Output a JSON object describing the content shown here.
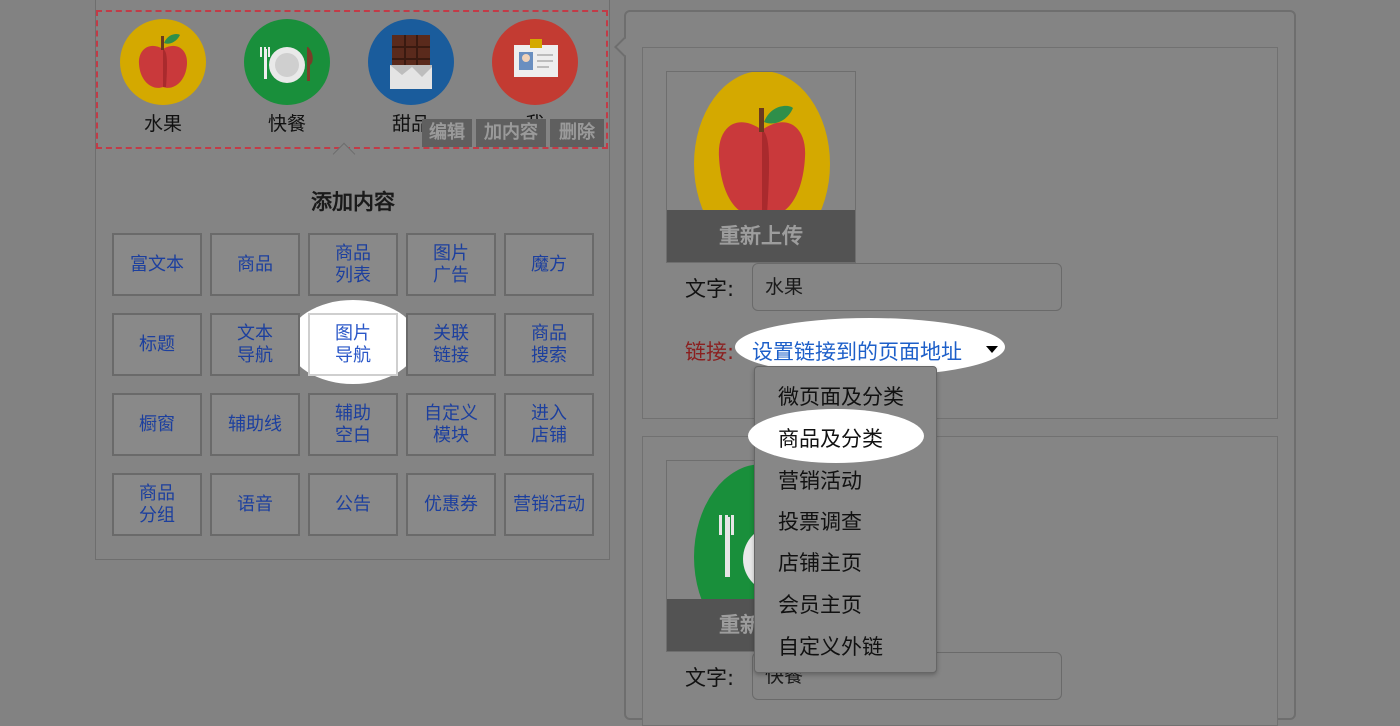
{
  "nav_preview": {
    "items": [
      {
        "label": "水果",
        "icon": "apple-icon",
        "color": "#d4a900"
      },
      {
        "label": "快餐",
        "icon": "plate-cutlery-icon",
        "color": "#198f3b"
      },
      {
        "label": "甜品",
        "icon": "chocolate-icon",
        "color": "#1a5c9c"
      },
      {
        "label": "我",
        "icon": "id-badge-icon",
        "color": "#c33b32"
      }
    ],
    "tools": {
      "edit": "编辑",
      "add": "加内容",
      "delete": "删除"
    }
  },
  "add_content": {
    "title": "添加内容",
    "buttons": [
      "富文本",
      "商品",
      "商品\n列表",
      "图片\n广告",
      "魔方",
      "标题",
      "文本\n导航",
      "图片\n导航",
      "关联\n链接",
      "商品\n搜索",
      "橱窗",
      "辅助线",
      "辅助\n空白",
      "自定义\n模块",
      "进入\n店铺",
      "商品\n分组",
      "语音",
      "公告",
      "优惠券",
      "营销活动"
    ]
  },
  "editor": {
    "card1": {
      "reupload": "重新上传",
      "text_label": "文字:",
      "text_value": "水果",
      "link_label": "链接:",
      "link_select": "设置链接到的页面地址"
    },
    "card2": {
      "reupload": "重新上传",
      "text_label": "文字:",
      "text_value": "快餐"
    },
    "link_dropdown": [
      "微页面及分类",
      "商品及分类",
      "营销活动",
      "投票调查",
      "店铺主页",
      "会员主页",
      "自定义外链"
    ]
  },
  "colors": {
    "accent_link": "#1d5fc9",
    "link_label": "#8b1f1f",
    "dashed_border": "#c23b47"
  }
}
